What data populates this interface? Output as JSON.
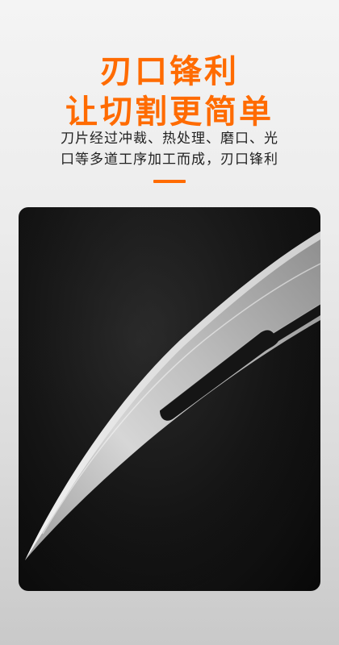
{
  "headline": {
    "line1": "刃口锋利",
    "line2": "让切割更简单"
  },
  "description": {
    "line1": "刀片经过冲裁、热处理、磨口、光",
    "line2": "口等多道工序加工而成，刃口锋利"
  },
  "colors": {
    "accent": "#ff6b00",
    "panel_bg": "#111111"
  },
  "icons": {
    "product": "scalpel-blade"
  }
}
